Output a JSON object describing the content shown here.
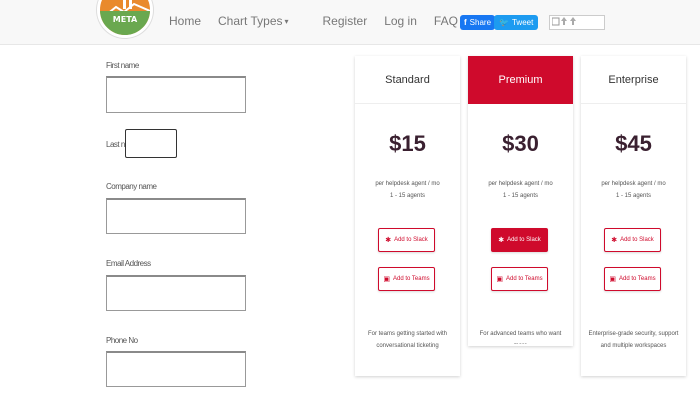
{
  "navbar": {
    "logo_text": "META",
    "links": [
      {
        "label": "Home"
      },
      {
        "label": "Chart Types",
        "caret": "▾"
      },
      {
        "label": "Register"
      },
      {
        "label": "Log in"
      },
      {
        "label": "FAQ"
      }
    ],
    "share_icon": "f",
    "share_label": "Share",
    "tweet_icon": "🐦",
    "tweet_label": "Tweet"
  },
  "form": {
    "first_name_label": "First name",
    "last_name_label": "Last name",
    "first_name_value": "",
    "last_name_value": "",
    "company_label": "Company name",
    "email_label": "Email Address",
    "phone_label": "Phone No"
  },
  "pricing": {
    "accent_color": "#cf0a2c",
    "plans": [
      {
        "name": "Standard",
        "price": "$15",
        "per": "per helpdesk agent / mo",
        "agents": "1 - 15 agents",
        "slack": "Add to Slack",
        "teams": "Add to Teams",
        "desc": "For teams getting started with conversational ticketing"
      },
      {
        "name": "Premium",
        "price": "$30",
        "per": "per helpdesk agent / mo",
        "agents": "1 - 15 agents",
        "slack": "Add to Slack",
        "teams": "Add to Teams",
        "desc": "For advanced teams who want more"
      },
      {
        "name": "Enterprise",
        "price": "$45",
        "per": "per helpdesk agent / mo",
        "agents": "1 - 15 agents",
        "slack": "Add to Slack",
        "teams": "Add to Teams",
        "desc": "Enterprise-grade security, support and multiple workspaces"
      }
    ]
  }
}
